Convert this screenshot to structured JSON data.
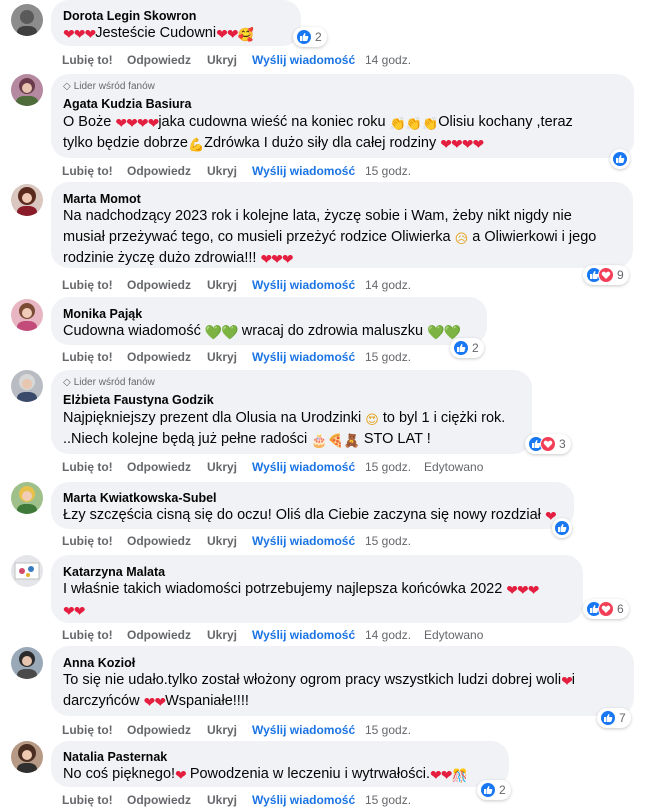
{
  "actions": {
    "like": "Lubię to!",
    "reply": "Odpowiedz",
    "hide": "Ukryj",
    "message": "Wyślij wiadomość",
    "edited": "Edytowano"
  },
  "badge_label": "Lider wśród fanów",
  "colors": {
    "bubble": "#f0f2f5",
    "like_blue": "#1877f2",
    "love_red": "#f33e58",
    "link_blue": "#1b74e4",
    "meta_gray": "#65676b"
  },
  "comments": [
    {
      "author": "Dorota Legin Skowron",
      "lines": [
        "Jesteście Cudowni"
      ],
      "reactions": "2",
      "time": "14 godz."
    },
    {
      "author": "Agata Kudzia Basiura",
      "badge": "Lider wśród fanów",
      "lines": [
        "O Boże",
        "jaka cudowna wieść na koniec roku",
        "Olisiu kochany ,teraz",
        "tylko będzie dobrze",
        "Zdrówka I dużo siły dla całej rodziny"
      ],
      "time": "15 godz."
    },
    {
      "author": "Marta Momot",
      "lines": [
        "Na nadchodzący 2023 rok i kolejne lata, życzę sobie i Wam, żeby nikt nigdy nie",
        "musiał przeżywać tego, co musieli przeżyć rodzice Oliwierka",
        "a Oliwierkowi i jego",
        "rodzinie życzę dużo zdrowia!!!"
      ],
      "reactions": "9",
      "time": "14 godz."
    },
    {
      "author": "Monika Pająk",
      "lines": [
        "Cudowna wiadomość",
        "wracaj do zdrowia maluszku"
      ],
      "reactions": "2",
      "time": "15 godz."
    },
    {
      "author": "Elżbieta Faustyna Godzik",
      "badge": "Lider wśród fanów",
      "lines": [
        "Najpiękniejszy prezent dla Olusia na Urodzinki",
        "to byl 1 i ciężki rok.",
        "..Niech kolejne będą już pełne radości",
        "STO LAT !"
      ],
      "reactions": "3",
      "time": "15 godz."
    },
    {
      "author": "Marta Kwiatkowska-Subel",
      "lines": [
        "Łzy szczęścia cisną się do oczu! Oliś dla Ciebie zaczyna się nowy rozdział"
      ],
      "time": "15 godz."
    },
    {
      "author": "Katarzyna Malata",
      "lines": [
        "I właśnie takich wiadomości potrzebujemy najlepsza końcówka 2022"
      ],
      "reactions": "6",
      "time": "14 godz."
    },
    {
      "author": "Anna Kozioł",
      "lines": [
        "To się nie udało.tylko został włożony ogrom pracy wszystkich ludzi dobrej woli",
        "i",
        "darczyńców",
        "Wspaniałe!!!!"
      ],
      "reactions": "7",
      "time": "15 godz."
    },
    {
      "author": "Natalia Pasternak",
      "lines": [
        "No coś pięknego!",
        "Powodzenia w leczeniu i wytrwałości."
      ],
      "reactions": "2",
      "time": "15 godz."
    }
  ],
  "icons": [
    "like-icon",
    "love-icon",
    "heart-emoji",
    "green-heart-emoji",
    "clap-emoji",
    "muscle-emoji",
    "sad-emoji",
    "heart-eyes-emoji",
    "cake-emoji",
    "teddy-bear-emoji",
    "pizza-emoji",
    "flexed-biceps-emoji",
    "diamond-icon"
  ]
}
